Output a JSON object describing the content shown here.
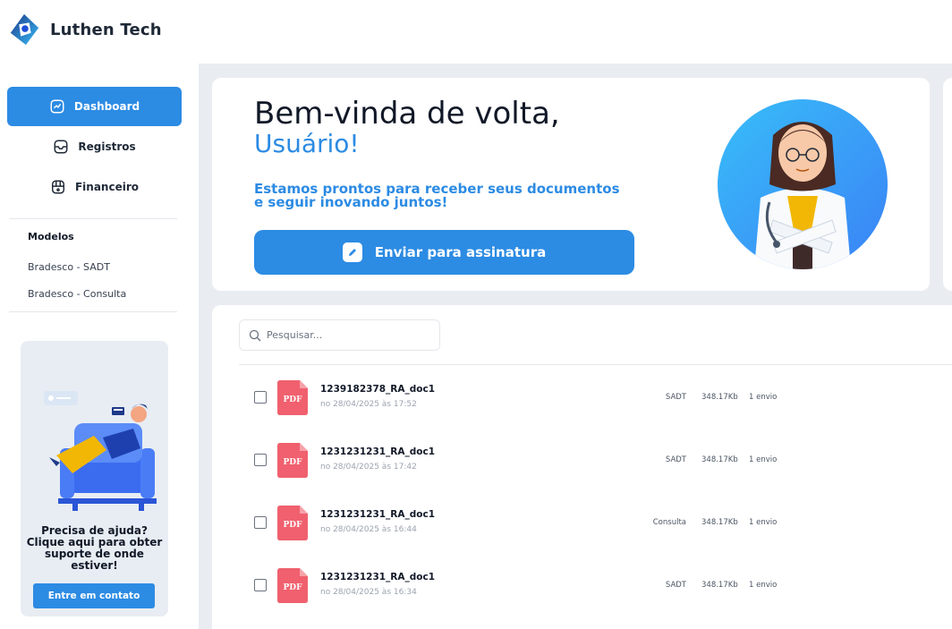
{
  "app": {
    "name": "Luthen Tech"
  },
  "colors": {
    "primary": "#2c8be3",
    "background": "#e9edf2",
    "pdf": "#f0606e"
  },
  "sidebar": {
    "items": [
      {
        "label": "Dashboard",
        "icon": "dashboard-icon",
        "active": true
      },
      {
        "label": "Registros",
        "icon": "inbox-icon",
        "active": false
      },
      {
        "label": "Financeiro",
        "icon": "wallet-icon",
        "active": false
      }
    ],
    "models_title": "Modelos",
    "models": [
      "Bradesco - SADT",
      "Bradesco - Consulta"
    ],
    "help": {
      "text": "Precisa de ajuda? Clique aqui para obter suporte de onde estiver!",
      "button": "Entre em contato"
    }
  },
  "welcome": {
    "title": "Bem-vinda de volta,",
    "user": "Usuário!",
    "subtitle": "Estamos prontos para receber seus documentos e seguir inovando juntos!",
    "button": "Enviar para assinatura"
  },
  "search": {
    "placeholder": "Pesquisar..."
  },
  "documents": [
    {
      "name": "1239182378_RA_doc1",
      "date": "no 28/04/2025 às 17:52",
      "type": "SADT",
      "size": "348.17Kb",
      "sends": "1 envio"
    },
    {
      "name": "1231231231_RA_doc1",
      "date": "no 28/04/2025 às 17:42",
      "type": "SADT",
      "size": "348.17Kb",
      "sends": "1 envio"
    },
    {
      "name": "1231231231_RA_doc1",
      "date": "no 28/04/2025 às 16:44",
      "type": "Consulta",
      "size": "348.17Kb",
      "sends": "1 envio"
    },
    {
      "name": "1231231231_RA_doc1",
      "date": "no 28/04/2025 às 16:34",
      "type": "SADT",
      "size": "348.17Kb",
      "sends": "1 envio"
    }
  ]
}
